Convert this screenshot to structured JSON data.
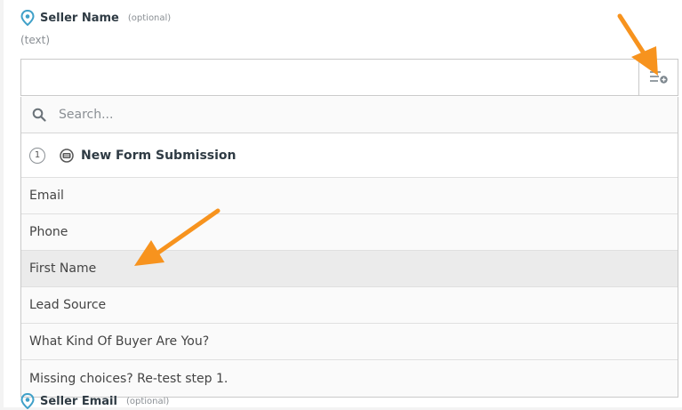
{
  "field": {
    "label": "Seller Name",
    "optional": "(optional)",
    "type_hint": "(text)"
  },
  "input": {
    "value": ""
  },
  "insert_button": {
    "icon": "insert-data-icon"
  },
  "dropdown": {
    "search_placeholder": "Search...",
    "group": {
      "step_number": "1",
      "title": "New Form Submission",
      "icon": "form-app-icon"
    },
    "options": [
      "Email",
      "Phone",
      "First Name",
      "Lead Source",
      "What Kind Of Buyer Are You?",
      "Missing choices? Re-test step 1."
    ]
  },
  "next_field": {
    "label": "Seller Email",
    "optional": "(optional)"
  },
  "colors": {
    "accent": "#3fa0c8",
    "annotation_arrow": "#f7931e"
  }
}
